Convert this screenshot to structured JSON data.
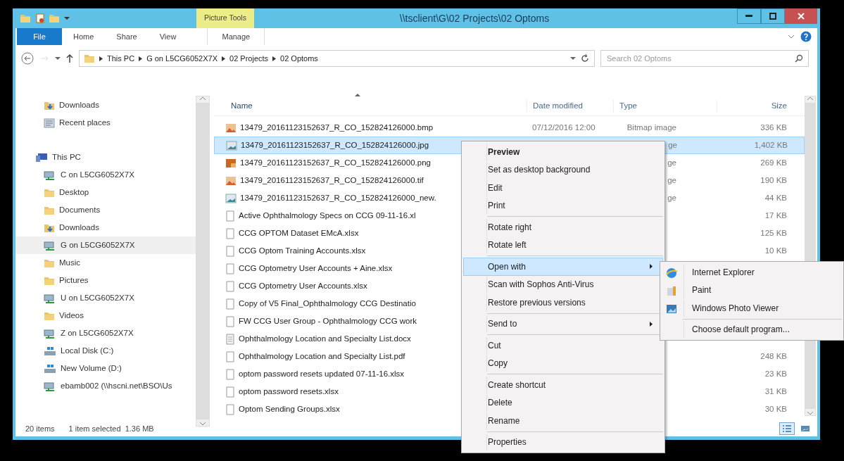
{
  "window": {
    "title": "\\\\tsclient\\G\\02 Projects\\02 Optoms",
    "context_header": "Picture Tools"
  },
  "ribbon_tabs": [
    {
      "label": "File",
      "kind": "file"
    },
    {
      "label": "Home",
      "kind": "tab"
    },
    {
      "label": "Share",
      "kind": "tab"
    },
    {
      "label": "View",
      "kind": "tab"
    },
    {
      "label": "Manage",
      "kind": "contextual"
    }
  ],
  "address": {
    "segments": [
      "This PC",
      "G on L5CG6052X7X",
      "02 Projects",
      "02 Optoms"
    ]
  },
  "search": {
    "placeholder": "Search 02 Optoms"
  },
  "sidebar": {
    "sections": [
      {
        "items": [
          {
            "label": "Downloads",
            "kind": "downloads",
            "selected": false
          },
          {
            "label": "Recent places",
            "kind": "recent",
            "selected": false
          }
        ]
      },
      {
        "label": "This PC",
        "kind": "pc",
        "items": [
          {
            "label": "C on L5CG6052X7X",
            "kind": "netdrive",
            "selected": false
          },
          {
            "label": "Desktop",
            "kind": "folder",
            "selected": false
          },
          {
            "label": "Documents",
            "kind": "folder",
            "selected": false
          },
          {
            "label": "Downloads",
            "kind": "downloads",
            "selected": false
          },
          {
            "label": "G on L5CG6052X7X",
            "kind": "netdrive",
            "selected": true
          },
          {
            "label": "Music",
            "kind": "folder",
            "selected": false
          },
          {
            "label": "Pictures",
            "kind": "folder",
            "selected": false
          },
          {
            "label": "U on L5CG6052X7X",
            "kind": "netdrive",
            "selected": false
          },
          {
            "label": "Videos",
            "kind": "folder",
            "selected": false
          },
          {
            "label": "Z on L5CG6052X7X",
            "kind": "netdrive",
            "selected": false
          },
          {
            "label": "Local Disk (C:)",
            "kind": "disk",
            "selected": false
          },
          {
            "label": "New Volume (D:)",
            "kind": "disk",
            "selected": false
          },
          {
            "label": "ebamb002 (\\\\hscni.net\\BSO\\Us",
            "kind": "netdrive",
            "selected": false
          }
        ]
      }
    ]
  },
  "files": {
    "columns": [
      {
        "label": "Name",
        "sorted": true
      },
      {
        "label": "Date modified",
        "sorted": false
      },
      {
        "label": "Type",
        "sorted": false
      },
      {
        "label": "Size",
        "sorted": false
      }
    ],
    "rows": [
      {
        "name": "13479_20161123152637_R_CO_152824126000.bmp",
        "date": "07/12/2016 12:00",
        "type": "Bitmap image",
        "size": "336 KB",
        "kind": "image",
        "selected": false
      },
      {
        "name": "13479_20161123152637_R_CO_152824126000.jpg",
        "type": "ge",
        "size": "1,402 KB",
        "kind": "photo",
        "selected": true
      },
      {
        "name": "13479_20161123152637_R_CO_152824126000.png",
        "type": "ge",
        "size": "269 KB",
        "kind": "png",
        "selected": false
      },
      {
        "name": "13479_20161123152637_R_CO_152824126000.tif",
        "type": "ge",
        "size": "190 KB",
        "kind": "image",
        "selected": false
      },
      {
        "name": "13479_20161123152637_R_CO_152824126000_new.",
        "type": "ge",
        "size": "44 KB",
        "kind": "photo",
        "selected": false
      },
      {
        "name": "Active Ophthalmology Specs on CCG 09-11-16.xl",
        "size": "17 KB",
        "kind": "doc",
        "selected": false
      },
      {
        "name": "CCG OPTOM Dataset EMcA.xlsx",
        "size": "125 KB",
        "kind": "doc",
        "selected": false
      },
      {
        "name": "CCG Optom Training Accounts.xlsx",
        "size": "10 KB",
        "kind": "doc",
        "selected": false
      },
      {
        "name": "CCG Optometry User Accounts + Aine.xlsx",
        "kind": "doc",
        "selected": false
      },
      {
        "name": "CCG Optometry User Accounts.xlsx",
        "kind": "doc",
        "selected": false
      },
      {
        "name": "Copy of V5 Final_Ophthalmology CCG Destinatio",
        "kind": "doc",
        "selected": false
      },
      {
        "name": "FW CCG  User Group - Ophthalmology CCG work",
        "kind": "doc",
        "selected": false
      },
      {
        "name": "Ophthalmology Location and Specialty List.docx",
        "kind": "text",
        "selected": false
      },
      {
        "name": "Ophthalmology Location and Specialty List.pdf",
        "size": "248 KB",
        "kind": "doc",
        "selected": false
      },
      {
        "name": "optom password resets updated 07-11-16.xlsx",
        "size": "23 KB",
        "kind": "doc",
        "selected": false
      },
      {
        "name": "optom password resets.xlsx",
        "size": "31 KB",
        "kind": "doc",
        "selected": false
      },
      {
        "name": "Optom Sending Groups.xlsx",
        "size": "30 KB",
        "kind": "doc",
        "selected": false
      }
    ]
  },
  "status_bar": {
    "count": "20 items",
    "selection": "1 item selected  1.36 MB"
  },
  "view_buttons": [
    {
      "kind": "details",
      "selected": true
    },
    {
      "kind": "thumbnails",
      "selected": false
    }
  ],
  "context_menu": {
    "groups": [
      [
        {
          "label": "Preview",
          "default": true,
          "selected": false,
          "submenu": false
        },
        {
          "label": "Set as desktop background",
          "default": false,
          "selected": false,
          "submenu": false
        },
        {
          "label": "Edit",
          "default": false,
          "selected": false,
          "submenu": false
        },
        {
          "label": "Print",
          "default": false,
          "selected": false,
          "submenu": false
        }
      ],
      [
        {
          "label": "Rotate right",
          "default": false,
          "selected": false,
          "submenu": false
        },
        {
          "label": "Rotate left",
          "default": false,
          "selected": false,
          "submenu": false
        }
      ],
      [
        {
          "label": "Open with",
          "default": false,
          "selected": true,
          "submenu": true
        },
        {
          "label": "Scan with Sophos Anti-Virus",
          "default": false,
          "selected": false,
          "submenu": false
        },
        {
          "label": "Restore previous versions",
          "default": false,
          "selected": false,
          "submenu": false
        }
      ],
      [
        {
          "label": "Send to",
          "default": false,
          "selected": false,
          "submenu": true
        }
      ],
      [
        {
          "label": "Cut",
          "default": false,
          "selected": false,
          "submenu": false
        },
        {
          "label": "Copy",
          "default": false,
          "selected": false,
          "submenu": false
        }
      ],
      [
        {
          "label": "Create shortcut",
          "default": false,
          "selected": false,
          "submenu": false
        },
        {
          "label": "Delete",
          "default": false,
          "selected": false,
          "submenu": false
        },
        {
          "label": "Rename",
          "default": false,
          "selected": false,
          "submenu": false
        }
      ],
      [
        {
          "label": "Properties",
          "default": false,
          "selected": false,
          "submenu": false
        }
      ]
    ]
  },
  "open_with_menu": {
    "groups": [
      [
        {
          "label": "Internet Explorer",
          "kind": "browser"
        },
        {
          "label": "Paint",
          "kind": "paint"
        },
        {
          "label": "Windows Photo Viewer",
          "kind": "viewer"
        }
      ],
      [
        {
          "label": "Choose default program...",
          "kind": "none"
        }
      ]
    ]
  }
}
